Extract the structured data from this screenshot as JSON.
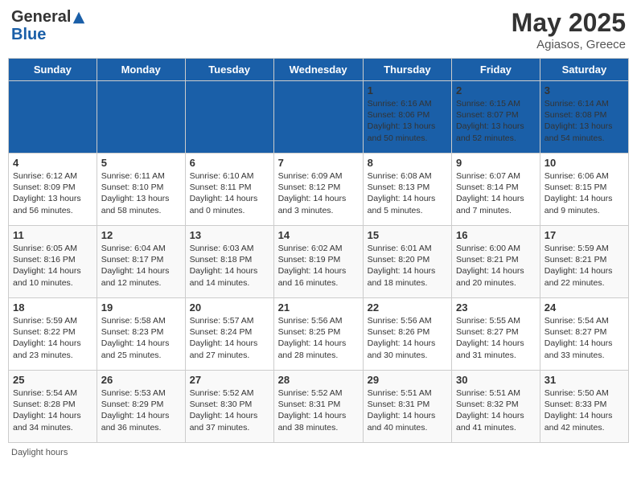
{
  "header": {
    "logo_general": "General",
    "logo_blue": "Blue",
    "month_title": "May 2025",
    "location": "Agiasos, Greece"
  },
  "days_of_week": [
    "Sunday",
    "Monday",
    "Tuesday",
    "Wednesday",
    "Thursday",
    "Friday",
    "Saturday"
  ],
  "weeks": [
    [
      {
        "day": "",
        "text": ""
      },
      {
        "day": "",
        "text": ""
      },
      {
        "day": "",
        "text": ""
      },
      {
        "day": "",
        "text": ""
      },
      {
        "day": "1",
        "text": "Sunrise: 6:16 AM\nSunset: 8:06 PM\nDaylight: 13 hours\nand 50 minutes."
      },
      {
        "day": "2",
        "text": "Sunrise: 6:15 AM\nSunset: 8:07 PM\nDaylight: 13 hours\nand 52 minutes."
      },
      {
        "day": "3",
        "text": "Sunrise: 6:14 AM\nSunset: 8:08 PM\nDaylight: 13 hours\nand 54 minutes."
      }
    ],
    [
      {
        "day": "4",
        "text": "Sunrise: 6:12 AM\nSunset: 8:09 PM\nDaylight: 13 hours\nand 56 minutes."
      },
      {
        "day": "5",
        "text": "Sunrise: 6:11 AM\nSunset: 8:10 PM\nDaylight: 13 hours\nand 58 minutes."
      },
      {
        "day": "6",
        "text": "Sunrise: 6:10 AM\nSunset: 8:11 PM\nDaylight: 14 hours\nand 0 minutes."
      },
      {
        "day": "7",
        "text": "Sunrise: 6:09 AM\nSunset: 8:12 PM\nDaylight: 14 hours\nand 3 minutes."
      },
      {
        "day": "8",
        "text": "Sunrise: 6:08 AM\nSunset: 8:13 PM\nDaylight: 14 hours\nand 5 minutes."
      },
      {
        "day": "9",
        "text": "Sunrise: 6:07 AM\nSunset: 8:14 PM\nDaylight: 14 hours\nand 7 minutes."
      },
      {
        "day": "10",
        "text": "Sunrise: 6:06 AM\nSunset: 8:15 PM\nDaylight: 14 hours\nand 9 minutes."
      }
    ],
    [
      {
        "day": "11",
        "text": "Sunrise: 6:05 AM\nSunset: 8:16 PM\nDaylight: 14 hours\nand 10 minutes."
      },
      {
        "day": "12",
        "text": "Sunrise: 6:04 AM\nSunset: 8:17 PM\nDaylight: 14 hours\nand 12 minutes."
      },
      {
        "day": "13",
        "text": "Sunrise: 6:03 AM\nSunset: 8:18 PM\nDaylight: 14 hours\nand 14 minutes."
      },
      {
        "day": "14",
        "text": "Sunrise: 6:02 AM\nSunset: 8:19 PM\nDaylight: 14 hours\nand 16 minutes."
      },
      {
        "day": "15",
        "text": "Sunrise: 6:01 AM\nSunset: 8:20 PM\nDaylight: 14 hours\nand 18 minutes."
      },
      {
        "day": "16",
        "text": "Sunrise: 6:00 AM\nSunset: 8:21 PM\nDaylight: 14 hours\nand 20 minutes."
      },
      {
        "day": "17",
        "text": "Sunrise: 5:59 AM\nSunset: 8:21 PM\nDaylight: 14 hours\nand 22 minutes."
      }
    ],
    [
      {
        "day": "18",
        "text": "Sunrise: 5:59 AM\nSunset: 8:22 PM\nDaylight: 14 hours\nand 23 minutes."
      },
      {
        "day": "19",
        "text": "Sunrise: 5:58 AM\nSunset: 8:23 PM\nDaylight: 14 hours\nand 25 minutes."
      },
      {
        "day": "20",
        "text": "Sunrise: 5:57 AM\nSunset: 8:24 PM\nDaylight: 14 hours\nand 27 minutes."
      },
      {
        "day": "21",
        "text": "Sunrise: 5:56 AM\nSunset: 8:25 PM\nDaylight: 14 hours\nand 28 minutes."
      },
      {
        "day": "22",
        "text": "Sunrise: 5:56 AM\nSunset: 8:26 PM\nDaylight: 14 hours\nand 30 minutes."
      },
      {
        "day": "23",
        "text": "Sunrise: 5:55 AM\nSunset: 8:27 PM\nDaylight: 14 hours\nand 31 minutes."
      },
      {
        "day": "24",
        "text": "Sunrise: 5:54 AM\nSunset: 8:27 PM\nDaylight: 14 hours\nand 33 minutes."
      }
    ],
    [
      {
        "day": "25",
        "text": "Sunrise: 5:54 AM\nSunset: 8:28 PM\nDaylight: 14 hours\nand 34 minutes."
      },
      {
        "day": "26",
        "text": "Sunrise: 5:53 AM\nSunset: 8:29 PM\nDaylight: 14 hours\nand 36 minutes."
      },
      {
        "day": "27",
        "text": "Sunrise: 5:52 AM\nSunset: 8:30 PM\nDaylight: 14 hours\nand 37 minutes."
      },
      {
        "day": "28",
        "text": "Sunrise: 5:52 AM\nSunset: 8:31 PM\nDaylight: 14 hours\nand 38 minutes."
      },
      {
        "day": "29",
        "text": "Sunrise: 5:51 AM\nSunset: 8:31 PM\nDaylight: 14 hours\nand 40 minutes."
      },
      {
        "day": "30",
        "text": "Sunrise: 5:51 AM\nSunset: 8:32 PM\nDaylight: 14 hours\nand 41 minutes."
      },
      {
        "day": "31",
        "text": "Sunrise: 5:50 AM\nSunset: 8:33 PM\nDaylight: 14 hours\nand 42 minutes."
      }
    ]
  ],
  "footer": "Daylight hours"
}
